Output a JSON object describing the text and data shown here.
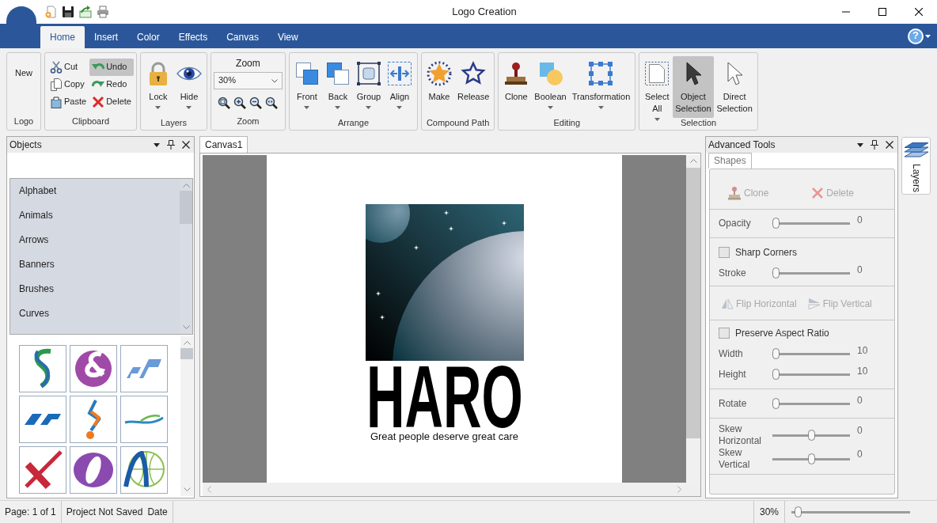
{
  "window": {
    "title": "Logo Creation"
  },
  "ribbon": {
    "tabs": [
      {
        "label": "Home",
        "selected": true
      },
      {
        "label": "Insert",
        "selected": false
      },
      {
        "label": "Color",
        "selected": false
      },
      {
        "label": "Effects",
        "selected": false
      },
      {
        "label": "Canvas",
        "selected": false
      },
      {
        "label": "View",
        "selected": false
      }
    ],
    "help": {
      "label": "?"
    },
    "groups": [
      {
        "label": "Logo",
        "items": [
          {
            "kind": "text",
            "label": "New",
            "highlighted": false
          }
        ]
      },
      {
        "label": "Clipboard",
        "items": [
          {
            "kind": "small",
            "label": "Cut",
            "highlighted": false
          },
          {
            "kind": "small",
            "label": "Copy",
            "highlighted": false
          },
          {
            "kind": "small",
            "label": "Paste",
            "highlighted": false
          },
          {
            "kind": "small",
            "label": "Undo",
            "highlighted": true
          },
          {
            "kind": "small",
            "label": "Redo",
            "highlighted": false
          },
          {
            "kind": "small",
            "label": "Delete",
            "highlighted": false
          }
        ]
      },
      {
        "label": "Layers",
        "items": [
          {
            "kind": "large",
            "label": "Lock",
            "dropdown": true,
            "highlighted": false
          },
          {
            "kind": "large",
            "label": "Hide",
            "dropdown": true,
            "highlighted": false
          }
        ]
      },
      {
        "label": "Zoom",
        "items": [
          {
            "kind": "caption",
            "label": "Zoom"
          },
          {
            "kind": "combo",
            "value": "30%"
          },
          {
            "kind": "zoomtools"
          }
        ]
      },
      {
        "label": "Arrange",
        "items": [
          {
            "kind": "large",
            "label": "Front",
            "dropdown": true,
            "highlighted": false
          },
          {
            "kind": "large",
            "label": "Back",
            "dropdown": true,
            "highlighted": false
          },
          {
            "kind": "large",
            "label": "Group",
            "dropdown": true,
            "highlighted": false
          },
          {
            "kind": "large",
            "label": "Align",
            "dropdown": true,
            "highlighted": false
          }
        ]
      },
      {
        "label": "Compound Path",
        "items": [
          {
            "kind": "large",
            "label": "Make",
            "dropdown": false,
            "highlighted": false
          },
          {
            "kind": "large",
            "label": "Release",
            "dropdown": false,
            "highlighted": false
          }
        ]
      },
      {
        "label": "Editing",
        "items": [
          {
            "kind": "large",
            "label": "Clone",
            "dropdown": false,
            "highlighted": false
          },
          {
            "kind": "large",
            "label": "Boolean",
            "dropdown": true,
            "highlighted": false
          },
          {
            "kind": "large",
            "label": "Transformation",
            "dropdown": true,
            "highlighted": false
          }
        ]
      },
      {
        "label": "Selection",
        "items": [
          {
            "kind": "large",
            "label": "Select All",
            "dropdown": true,
            "highlighted": false
          },
          {
            "kind": "large",
            "label": "Object Selection",
            "dropdown": false,
            "highlighted": true
          },
          {
            "kind": "large",
            "label": "Direct Selection",
            "dropdown": false,
            "highlighted": false
          }
        ]
      }
    ]
  },
  "objects_panel": {
    "title": "Objects",
    "categories": [
      {
        "label": "Alphabet",
        "selected": false
      },
      {
        "label": "Animals",
        "selected": false
      },
      {
        "label": "Arrows",
        "selected": false
      },
      {
        "label": "Banners",
        "selected": false
      },
      {
        "label": "Brushes",
        "selected": false
      },
      {
        "label": "Curves",
        "selected": false
      }
    ]
  },
  "canvas": {
    "tabs": [
      {
        "label": "Canvas1",
        "selected": true
      }
    ],
    "logo": {
      "title": "HARO",
      "tagline": "Great people deserve great care"
    }
  },
  "advanced_tools": {
    "title": "Advanced Tools",
    "tabs": [
      {
        "label": "Shapes",
        "selected": true
      }
    ],
    "sections": [
      {
        "items": [
          {
            "kind": "button",
            "label": "Clone",
            "disabled": true
          },
          {
            "kind": "button",
            "label": "Delete",
            "disabled": true
          }
        ]
      },
      {
        "items": [
          {
            "kind": "slider",
            "label": "Opacity",
            "level": 0,
            "reading": "0"
          }
        ]
      },
      {
        "items": [
          {
            "kind": "checkbox",
            "label": "Sharp Corners",
            "checked": false
          },
          {
            "kind": "slider",
            "label": "Stroke",
            "level": 0,
            "reading": "0"
          }
        ]
      },
      {
        "items": [
          {
            "kind": "button",
            "label": "Flip Horizontal",
            "disabled": true
          },
          {
            "kind": "button",
            "label": "Flip Vertical",
            "disabled": true
          }
        ]
      },
      {
        "items": [
          {
            "kind": "checkbox",
            "label": "Preserve Aspect Ratio",
            "checked": false
          },
          {
            "kind": "slider",
            "label": "Width",
            "level": 0,
            "reading": "10"
          },
          {
            "kind": "slider",
            "label": "Height",
            "level": 0,
            "reading": "10"
          }
        ]
      },
      {
        "items": [
          {
            "kind": "slider",
            "label": "Rotate",
            "level": 0,
            "reading": "0"
          }
        ]
      },
      {
        "items": [
          {
            "kind": "slider",
            "label": "Skew Horizontal",
            "level": 0.5,
            "reading": "0"
          },
          {
            "kind": "slider",
            "label": "Skew Vertical",
            "level": 0.5,
            "reading": "0"
          }
        ]
      }
    ]
  },
  "side_tab": {
    "label": "Layers"
  },
  "status_bar": {
    "page": "Page: 1 of 1",
    "save_state": "Project Not Saved",
    "date": "Date",
    "zoom": "30%",
    "zoom_slider": {
      "level": 0.03
    }
  }
}
